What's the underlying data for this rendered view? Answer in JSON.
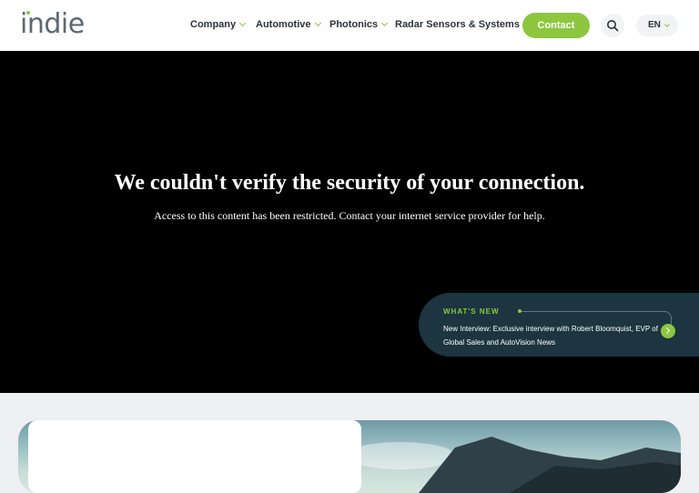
{
  "header": {
    "logo_text": "indie",
    "nav": [
      {
        "label": "Company"
      },
      {
        "label": "Automotive"
      },
      {
        "label": "Photonics"
      },
      {
        "label": "Radar Sensors & Systems"
      }
    ],
    "contact_label": "Contact",
    "language": "EN",
    "search_icon": "search-icon"
  },
  "hero": {
    "title": "We couldn't verify the security of your connection.",
    "subtitle": "Access to this content has been restricted. Contact your internet service provider for help."
  },
  "news": {
    "label": "WHAT'S NEW",
    "text": "New Interview: Exclusive interview with Robert Bloomquist, EVP of Global Sales and AutoVision News",
    "arrow_icon": "arrow-right-icon"
  },
  "colors": {
    "brand_green": "#8dc63f",
    "news_bg": "#1c3540",
    "hero_bg": "#000000"
  }
}
